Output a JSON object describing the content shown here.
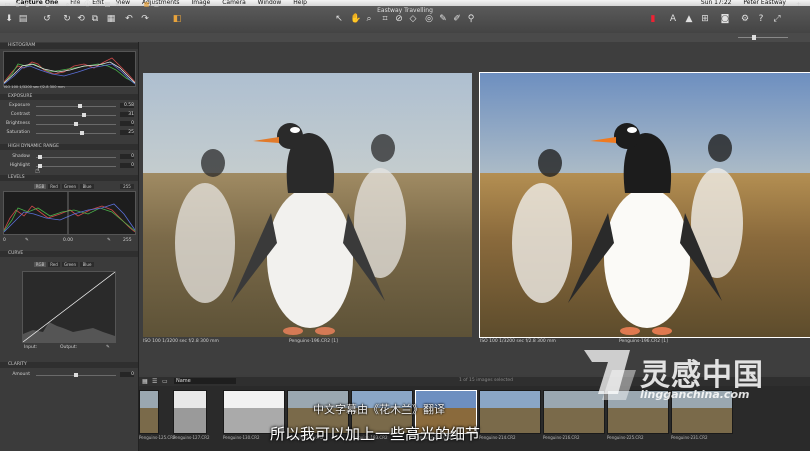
{
  "menubar": {
    "items": [
      "Capture One",
      "File",
      "Edit",
      "View",
      "Adjustments",
      "Image",
      "Camera",
      "Window",
      "Help"
    ],
    "clock": "Sun 17:22",
    "user": "Peter Eastway"
  },
  "window": {
    "title": "Eastway Travelling"
  },
  "left_panel": {
    "histogram": {
      "title": "HISTOGRAM",
      "info": "ISO 100   1/3200 sec   f/2.8   300 mm"
    },
    "exposure": {
      "title": "EXPOSURE",
      "sliders": [
        {
          "label": "Exposure",
          "value": "0.58",
          "level": 0.55
        },
        {
          "label": "Contrast",
          "value": "31",
          "level": 0.6
        },
        {
          "label": "Brightness",
          "value": "0",
          "level": 0.5
        },
        {
          "label": "Saturation",
          "value": "25",
          "level": 0.58
        }
      ]
    },
    "hdr": {
      "title": "HIGH DYNAMIC RANGE",
      "sliders": [
        {
          "label": "Shadow",
          "value": "0",
          "level": 0.05
        },
        {
          "label": "Highlight",
          "value": "0",
          "level": 0.05
        }
      ]
    },
    "levels": {
      "title": "LEVELS",
      "tabs": [
        "RGB",
        "Red",
        "Green",
        "Blue"
      ],
      "low": "0",
      "mid": "0.00",
      "high": "255",
      "high_top": "255"
    },
    "curve": {
      "title": "CURVE",
      "tabs": [
        "RGB",
        "Red",
        "Green",
        "Blue"
      ],
      "input_label": "Input:",
      "output_label": "Output:"
    },
    "clarity": {
      "title": "CLARITY",
      "sliders": [
        {
          "label": "Amount",
          "value": "0",
          "level": 0.5
        }
      ]
    }
  },
  "viewer": {
    "left_info": "ISO 100    1/3200 sec    f/2.8    300 mm",
    "left_name": "Penguins-196.CR2 [1]",
    "right_info": "ISO 100    1/3200 sec    f/2.8    300 mm",
    "right_name": "Penguins-196.CR2 [1]"
  },
  "filmstrip": {
    "sort_label": "Name",
    "counter": "1 of 15 images selected",
    "thumbs": [
      "Penguins-125.CR2",
      "Penguins-127.CR2",
      "Penguins-130.CR2",
      "Penguins-141.CR2",
      "Penguins-183.CR2",
      "Penguins-196.CR2",
      "Penguins-214.CR2",
      "Penguins-216.CR2",
      "Penguins-225.CR2",
      "Penguins-231.CR2"
    ]
  },
  "subtitles": {
    "line1": "中文字幕由《花木兰》翻译",
    "line2": "所以我可以加上一些高光的细节"
  },
  "watermark": {
    "brand": "灵感中国",
    "url": "lingganchina.com"
  },
  "colors": {
    "accent_orange": "#e8a33c",
    "panel_bg": "#3b3b3b"
  }
}
